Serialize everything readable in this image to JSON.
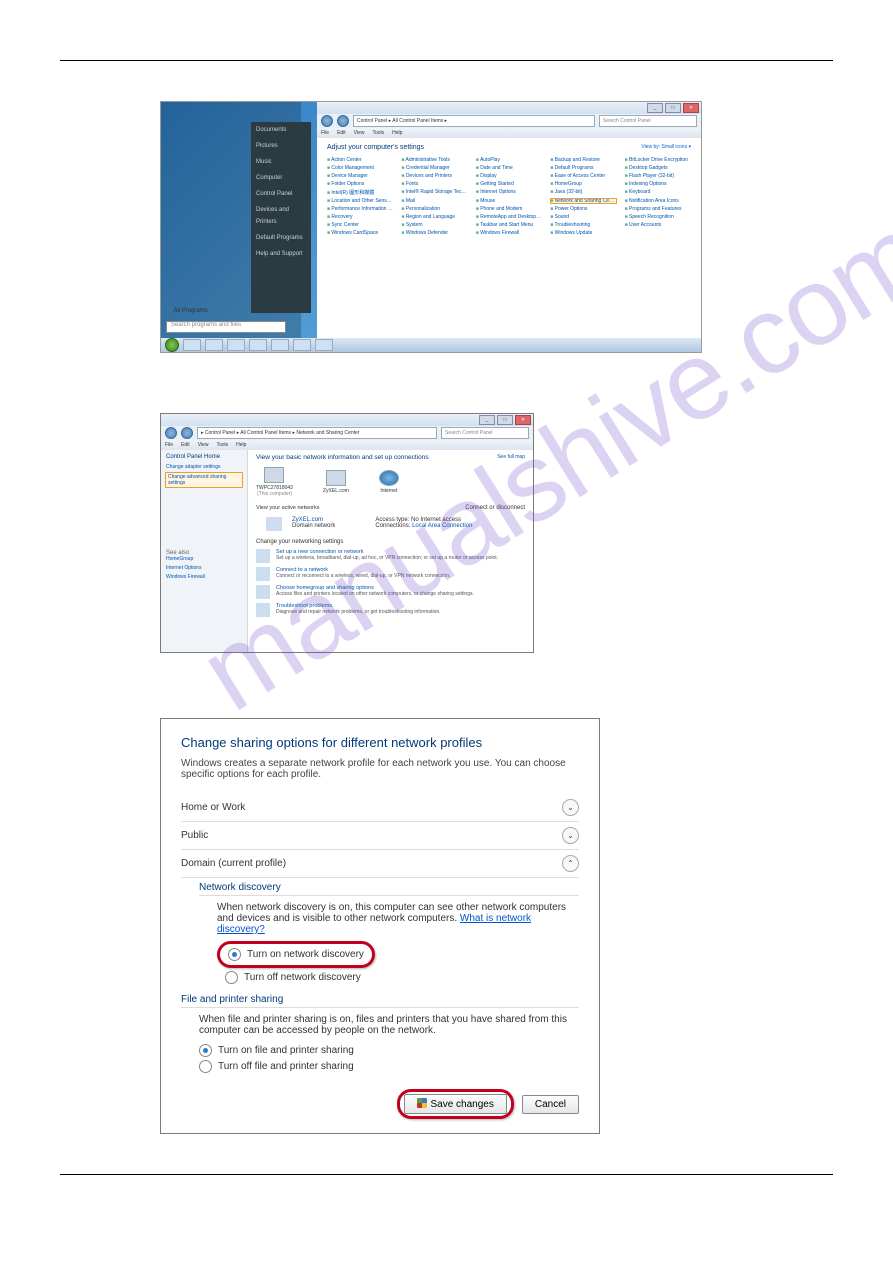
{
  "watermark": "manualshive.com",
  "ss1": {
    "startmenu": {
      "items": [
        "Documents",
        "Pictures",
        "Music",
        "Computer",
        "Control Panel",
        "Devices and Printers",
        "Default Programs",
        "Help and Support"
      ],
      "all_programs": "All Programs",
      "search_placeholder": "Search programs and files"
    },
    "cp": {
      "title_btns": [
        "_",
        "□",
        "✕"
      ],
      "address": "Control Panel ▸ All Control Panel Items ▸",
      "search_placeholder": "Search Control Panel",
      "menus": [
        "File",
        "Edit",
        "View",
        "Tools",
        "Help"
      ],
      "heading": "Adjust your computer's settings",
      "view_by": "View by: Small icons ▾",
      "items": [
        "Action Center",
        "Administrative Tools",
        "AutoPlay",
        "Backup and Restore",
        "BitLocker Drive Encryption",
        "Color Management",
        "Credential Manager",
        "Date and Time",
        "Default Programs",
        "Desktop Gadgets",
        "Device Manager",
        "Devices and Printers",
        "Display",
        "Ease of Access Center",
        "Flash Player (32-bit)",
        "Folder Options",
        "Fonts",
        "Getting Started",
        "HomeGroup",
        "Indexing Options",
        "Intel(R) 圖形和媒體",
        "Intel® Rapid Storage Technology",
        "Internet Options",
        "Java (32-bit)",
        "Keyboard",
        "Location and Other Sensors",
        "Mail",
        "Mouse",
        "Network and Sharing Center",
        "Notification Area Icons",
        "Performance Information and Tools",
        "Personalization",
        "Phone and Modem",
        "Power Options",
        "Programs and Features",
        "Recovery",
        "Region and Language",
        "RemoteApp and Desktop Connections",
        "Sound",
        "Speech Recognition",
        "Sync Center",
        "System",
        "Taskbar and Start Menu",
        "Troubleshooting",
        "User Accounts",
        "Windows CardSpace",
        "Windows Defender",
        "Windows Firewall",
        "Windows Update"
      ],
      "highlight_index": 28
    }
  },
  "ss2": {
    "title_btns": [
      "_",
      "□",
      "✕"
    ],
    "address": "▸ Control Panel ▸ All Control Panel Items ▸ Network and Sharing Center",
    "search_placeholder": "Search Control Panel",
    "menus": [
      "File",
      "Edit",
      "View",
      "Tools",
      "Help"
    ],
    "side": {
      "heading": "Control Panel Home",
      "links": [
        "Change adapter settings",
        "Change advanced sharing settings"
      ],
      "highlight_index": 1,
      "see_also": "See also",
      "see_links": [
        "HomeGroup",
        "Internet Options",
        "Windows Firewall"
      ]
    },
    "main": {
      "title": "View your basic network information and set up connections",
      "full_map": "See full map",
      "nodes": [
        {
          "label": "TWPC27818043",
          "sub": "(This computer)"
        },
        {
          "label": "ZyXEL.com",
          "sub": ""
        },
        {
          "label": "Internet",
          "sub": ""
        }
      ],
      "view_active": "View your active networks",
      "connect_link": "Connect or disconnect",
      "active": {
        "name": "ZyXEL.com",
        "type": "Domain network",
        "access_label": "Access type:",
        "access": "No Internet access",
        "conn_label": "Connections:",
        "conn": "Local Area Connection"
      },
      "change_heading": "Change your networking settings",
      "tasks": [
        {
          "h": "Set up a new connection or network",
          "d": "Set up a wireless, broadband, dial-up, ad hoc, or VPN connection; or set up a router or access point."
        },
        {
          "h": "Connect to a network",
          "d": "Connect or reconnect to a wireless, wired, dial-up, or VPN network connection."
        },
        {
          "h": "Choose homegroup and sharing options",
          "d": "Access files and printers located on other network computers, or change sharing settings."
        },
        {
          "h": "Troubleshoot problems",
          "d": "Diagnose and repair network problems, or get troubleshooting information."
        }
      ]
    }
  },
  "ss3": {
    "title": "Change sharing options for different network profiles",
    "desc": "Windows creates a separate network profile for each network you use. You can choose specific options for each profile.",
    "profiles": [
      {
        "label": "Home or Work",
        "expanded": false
      },
      {
        "label": "Public",
        "expanded": false
      },
      {
        "label": "Domain (current profile)",
        "expanded": true
      }
    ],
    "nd": {
      "heading": "Network discovery",
      "desc_a": "When network discovery is on, this computer can see other network computers and devices and is visible to other network computers. ",
      "desc_link": "What is network discovery?",
      "opt_on": "Turn on network discovery",
      "opt_off": "Turn off network discovery"
    },
    "fps": {
      "heading": "File and printer sharing",
      "desc": "When file and printer sharing is on, files and printers that you have shared from this computer can be accessed by people on the network.",
      "opt_on": "Turn on file and printer sharing",
      "opt_off": "Turn off file and printer sharing"
    },
    "save_btn": "Save changes",
    "cancel_btn": "Cancel"
  }
}
